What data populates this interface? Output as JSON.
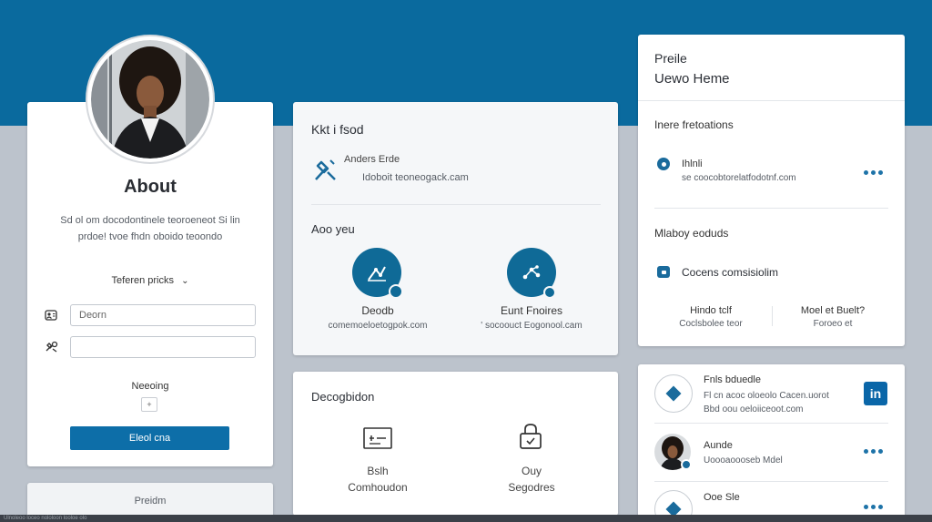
{
  "about": {
    "title": "About",
    "bio_line1": "Sd ol om docodontinele teoroeneot Si lin",
    "bio_line2": "prdoe! tvoe fhdn oboido teoondo",
    "dropdown_label": "Teferen pricks",
    "field1_placeholder": "Deorn",
    "field2_value": "",
    "small_label": "Neeoing",
    "button_label": "Eleol cna"
  },
  "about_footer": {
    "label": "Preidm"
  },
  "contact": {
    "title": "Kkt i fsod",
    "name": "Anders Erde",
    "email": "Idoboit teoneogack.cam",
    "section_title": "Aoo yeu",
    "item1_title": "Deodb",
    "item1_sub": "comemoeloetogpok.com",
    "item2_title": "Eunt Fnoires",
    "item2_sub": "' socoouct Eogonool.cam"
  },
  "description": {
    "title": "Decogbidon",
    "item1_line1": "Bslh",
    "item1_line2": "Comhoudon",
    "item2_line1": "Ouy",
    "item2_line2": "Segodres"
  },
  "profile": {
    "title": "Preile",
    "subtitle": "Uewo Heme",
    "section1": "Inere fretoations",
    "row1_title": "Ihlnli",
    "row1_sub": "se coocobtorelatfodotnf.com",
    "section2": "Mlaboy eoduds",
    "row2_title": "Cocens comsisiolim",
    "stat1_title": "Hindo tclf",
    "stat1_sub": "Coclsbolee teor",
    "stat2_title": "Moel et Buelt?",
    "stat2_sub": "Foroeo et"
  },
  "connections": {
    "item1_title": "Fnls bduedle",
    "item1_line1": "Fl cn acoc oloeolo Cacen.uorot",
    "item1_line2": "Bbd oou oeloiiceoot.com",
    "item2_title": "Aunde",
    "item2_sub": "Uoooaoooseb Mdel",
    "item3_title": "Ooe Sle",
    "linkedin_text": "in"
  },
  "footer": {
    "text": "Ulnoleoo loceo nololoon looloe olo"
  },
  "colors": {
    "brand": "#0a6a9e",
    "accent": "#0f6a97",
    "button": "#0d6ea8"
  }
}
